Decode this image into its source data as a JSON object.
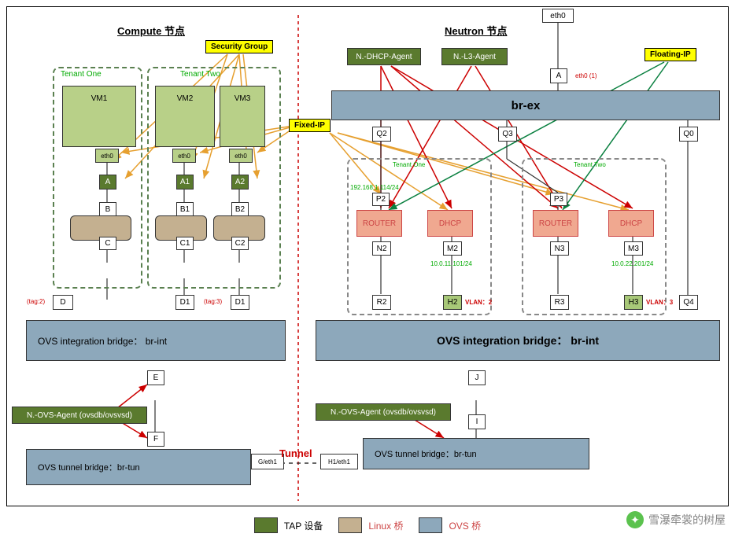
{
  "titles": {
    "compute": "Compute 节点",
    "neutron": "Neutron 节点"
  },
  "tags": {
    "security": "Security Group",
    "fixed": "Fixed-IP",
    "floating": "Floating-IP"
  },
  "tenants": {
    "one": "Tenant One",
    "two": "Tenant Two"
  },
  "vms": {
    "vm1": "VM1",
    "vm2": "VM2",
    "vm3": "VM3"
  },
  "ports": {
    "eth0": "eth0",
    "eth0_1": "eth0 (1)",
    "A": "A",
    "A1": "A1",
    "A2": "A2",
    "B": "B",
    "B1": "B1",
    "B2": "B2",
    "C": "C",
    "C1": "C1",
    "C2": "C2",
    "D": "D",
    "D1": "D1",
    "D1b": "D1",
    "E": "E",
    "F": "F",
    "G": "G/eth1",
    "H1": "H1/eth1",
    "I": "I",
    "J": "J",
    "Q0": "Q0",
    "Q2": "Q2",
    "Q3": "Q3",
    "Q4": "Q4",
    "P2": "P2",
    "P3": "P3",
    "N2": "N2",
    "N3": "N3",
    "M2": "M2",
    "M3": "M3",
    "R2": "R2",
    "R3": "R3",
    "H2": "H2",
    "H3": "H3"
  },
  "tagLabels": {
    "t2": "(tag:2)",
    "t3": "(tag:3)"
  },
  "agents": {
    "dhcp": "N.-DHCP-Agent",
    "l3": "N.-L3-Agent",
    "ovs": "N.-OVS-Agent (ovsdb/ovsvsd)",
    "ovs2": "N.-OVS-Agent (ovsdb/ovsvsd)"
  },
  "bridges": {
    "brex": "br-ex",
    "brint": "OVS integration bridge：  br-int",
    "brint2": "OVS integration bridge：  br-int",
    "brtun": "OVS tunnel bridge：br-tun",
    "brtun2": "OVS tunnel bridge：br-tun"
  },
  "netboxes": {
    "router": "ROUTER",
    "dhcp": "DHCP"
  },
  "ips": {
    "r1": "192.168.1.114/24",
    "d1": "10.0.11.101/24",
    "d2": "10.0.22.201/24"
  },
  "vlans": {
    "v2": "VLAN：2",
    "v3": "VLAN：3"
  },
  "tunnel": "Tunnel",
  "legend": {
    "tap": "TAP 设备",
    "linux": "Linux 桥",
    "ovs": "OVS 桥"
  },
  "watermark": "雪瀑牵裳的树屋"
}
